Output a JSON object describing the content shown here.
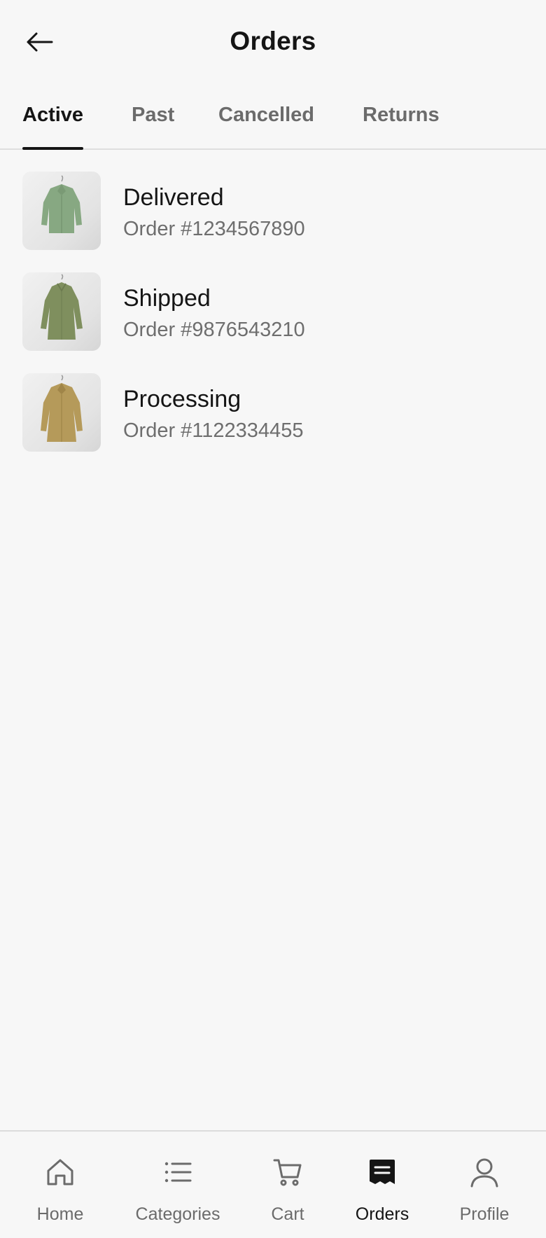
{
  "header": {
    "title": "Orders",
    "back_icon": "arrow-left-icon"
  },
  "tabs": [
    {
      "label": "Active",
      "active": true
    },
    {
      "label": "Past",
      "active": false
    },
    {
      "label": "Cancelled",
      "active": false
    },
    {
      "label": "Returns",
      "active": false
    }
  ],
  "orders": [
    {
      "status": "Delivered",
      "number": "Order #1234567890",
      "image": "green-shirt-thumbnail"
    },
    {
      "status": "Shipped",
      "number": "Order #9876543210",
      "image": "olive-tunic-thumbnail"
    },
    {
      "status": "Processing",
      "number": "Order #1122334455",
      "image": "tan-blouse-thumbnail"
    }
  ],
  "bottom_nav": [
    {
      "label": "Home",
      "icon": "home-icon",
      "active": false
    },
    {
      "label": "Categories",
      "icon": "list-icon",
      "active": false
    },
    {
      "label": "Cart",
      "icon": "cart-icon",
      "active": false
    },
    {
      "label": "Orders",
      "icon": "receipt-icon",
      "active": true
    },
    {
      "label": "Profile",
      "icon": "person-icon",
      "active": false
    }
  ],
  "colors": {
    "background": "#f7f7f7",
    "text_primary": "#151515",
    "text_secondary": "#6e6e6e",
    "divider": "#dedede"
  }
}
